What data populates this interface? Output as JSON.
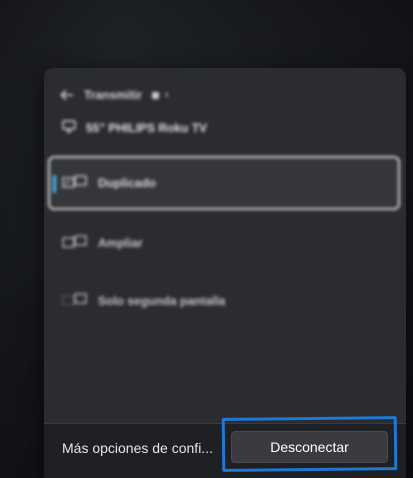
{
  "panel": {
    "header": {
      "title": "Transmitir",
      "back_icon": "back-arrow-icon"
    },
    "device": {
      "name": "55\" PHILIPS Roku TV",
      "icon": "monitor-icon"
    },
    "modes": [
      {
        "label": "Duplicado",
        "icon": "duplicate-display-icon",
        "selected": true
      },
      {
        "label": "Ampliar",
        "icon": "extend-display-icon",
        "selected": false
      },
      {
        "label": "Solo segunda pantalla",
        "icon": "second-screen-only-icon",
        "selected": false
      }
    ],
    "footer": {
      "more_options": "Más opciones de confi...",
      "disconnect_label": "Desconectar"
    }
  },
  "colors": {
    "accent": "#4cc2ff",
    "annotation": "#1f78d1",
    "panel_bg": "#2b2c30",
    "footer_bg": "#1f2023"
  }
}
